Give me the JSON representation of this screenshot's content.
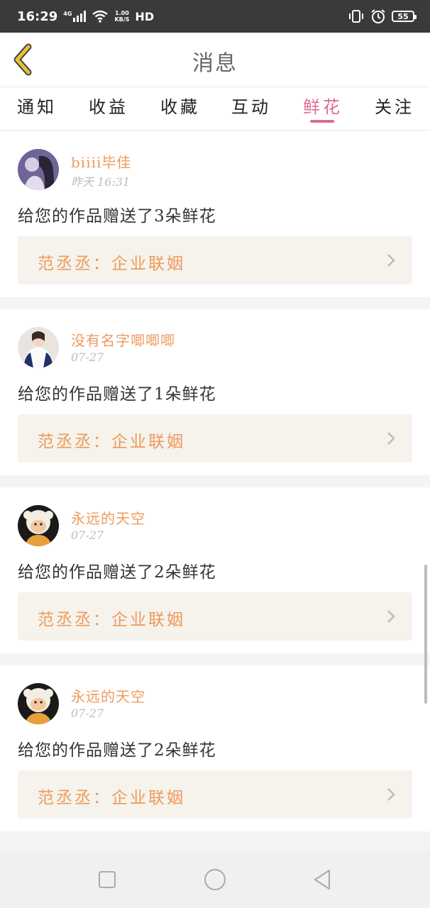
{
  "status_bar": {
    "time": "16:29",
    "net_type": "4G",
    "speed_value": "1.00",
    "speed_unit": "KB/S",
    "hd": "HD",
    "battery": "55"
  },
  "header": {
    "title": "消息"
  },
  "tabs": [
    {
      "label": "通知",
      "active": false
    },
    {
      "label": "收益",
      "active": false
    },
    {
      "label": "收藏",
      "active": false
    },
    {
      "label": "互动",
      "active": false
    },
    {
      "label": "鲜花",
      "active": true
    },
    {
      "label": "关注",
      "active": false
    }
  ],
  "messages": [
    {
      "name": "biiii毕佳",
      "time": "昨天 16:31",
      "text": "给您的作品赠送了3朵鲜花",
      "work": "范丞丞：企业联姻",
      "avatar": "avatar-girl-dark"
    },
    {
      "name": "没有名字唧唧唧",
      "time": "07-27",
      "text": "给您的作品赠送了1朵鲜花",
      "work": "范丞丞：企业联姻",
      "avatar": "avatar-girl-jacket"
    },
    {
      "name": "永远的天空",
      "time": "07-27",
      "text": "给您的作品赠送了2朵鲜花",
      "work": "范丞丞：企业联姻",
      "avatar": "avatar-cartoon-sheep"
    },
    {
      "name": "永远的天空",
      "time": "07-27",
      "text": "给您的作品赠送了2朵鲜花",
      "work": "范丞丞：企业联姻",
      "avatar": "avatar-cartoon-sheep"
    }
  ],
  "colors": {
    "accent_pink": "#e06a98",
    "name_orange": "#ee9a5c",
    "back_yellow": "#e8c236"
  }
}
